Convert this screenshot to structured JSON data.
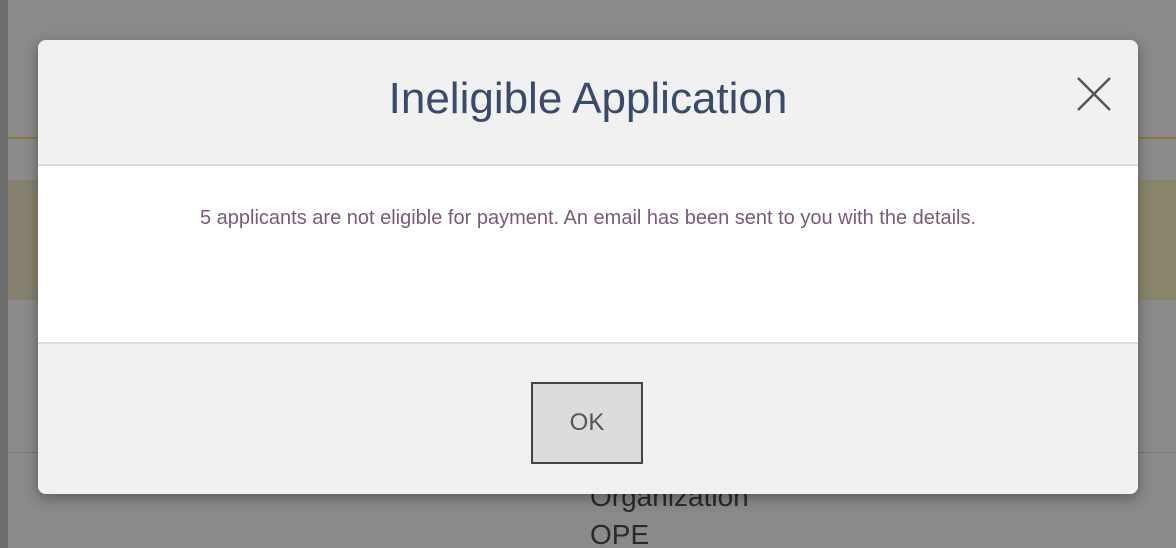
{
  "modal": {
    "title": "Ineligible Application",
    "message": "5 applicants are not eligible for payment. An email has been sent to you with the details.",
    "ok_label": "OK",
    "close_icon": "close-icon"
  },
  "background": {
    "bottom_right_line1": "Organization",
    "bottom_right_line2": "OPE"
  },
  "colors": {
    "title": "#3a4a6a",
    "message": "#7a5a78",
    "overlay": "#888888"
  }
}
